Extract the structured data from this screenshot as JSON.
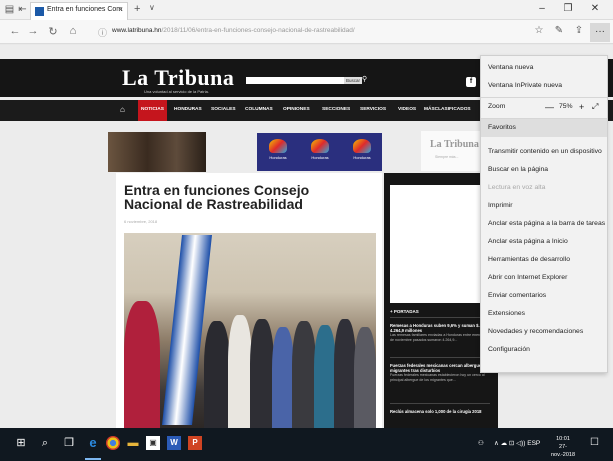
{
  "browser": {
    "tab_title": "Entra en funciones Com",
    "tab_close": "×",
    "new_tab": "+",
    "tab_dropdown": "∨",
    "window": {
      "minimize": "–",
      "maximize": "❐",
      "close": "✕"
    },
    "nav": {
      "back": "←",
      "forward": "→",
      "refresh": "↻",
      "home": "⌂"
    },
    "url_host": "www.latribuna.hn",
    "url_path": "/2018/11/06/entra-en-funciones-consejo-nacional-de-rastreabilidad/",
    "icons": {
      "reading": "☆",
      "favorites": "☆",
      "notes": "✎",
      "share": "⇪",
      "more": "···"
    }
  },
  "site": {
    "logo": "La Tribuna",
    "tagline": "Una voluntad al servicio de la Patria.",
    "search_button": "Buscar",
    "social": "f",
    "nav_items": [
      "NOTICIAS",
      "HONDURAS",
      "SOCIALES",
      "COLUMNAS",
      "OPINIONES",
      "SECCIONES",
      "SERVICIOS",
      "VIDEOS",
      "MÁSCLASIFICADOS"
    ],
    "ad2_labels": [
      "Honduras",
      "Honduras",
      "Honduras"
    ],
    "ad3_logo": "La Tribuna",
    "ad3_tag": "Siempre más..."
  },
  "article": {
    "title": "Entra en funciones Consejo Nacional de Rastreabilidad",
    "date": "6 noviembre, 2018"
  },
  "sidebar": {
    "heading": "+ PORTADAS",
    "items": [
      {
        "title": "Remesas a Honduras suben 9,6% y suman $. 4.264,9 millones",
        "sub": "Las remesas familiares enviadas a Honduras entre enero y 15 de noviembre pasados sumaron 4.264,9..."
      },
      {
        "title": "Fuerzas federales mexicanas cercan albergue de migrantes tras disturbios",
        "sub": "Fuerzas federales mexicanas establecieron hoy un cerco al principal albergue de los migrantes que..."
      },
      {
        "title": "Reclús almacena solo 1,000 de la cirugía 2018",
        "sub": ""
      }
    ]
  },
  "menu": {
    "items": [
      {
        "label": "Ventana nueva",
        "enabled": true
      },
      {
        "label": "Ventana InPrivate nueva",
        "enabled": true
      },
      {
        "label": "Zoom",
        "enabled": true,
        "zoom_value": "75%",
        "zoom_minus": "—",
        "zoom_plus": "+",
        "zoom_full": "⤢"
      },
      {
        "label": "Favoritos",
        "enabled": true,
        "highlighted": true
      },
      {
        "label": "Transmitir contenido en un dispositivo",
        "enabled": true
      },
      {
        "label": "Buscar en la página",
        "enabled": true
      },
      {
        "label": "Lectura en voz alta",
        "enabled": false
      },
      {
        "label": "Imprimir",
        "enabled": true
      },
      {
        "label": "Anclar esta página a la barra de tareas",
        "enabled": true
      },
      {
        "label": "Anclar esta página a Inicio",
        "enabled": true
      },
      {
        "label": "Herramientas de desarrollo",
        "enabled": true
      },
      {
        "label": "Abrir con Internet Explorer",
        "enabled": true
      },
      {
        "label": "Enviar comentarios",
        "enabled": true
      },
      {
        "label": "Extensiones",
        "enabled": true
      },
      {
        "label": "Novedades y recomendaciones",
        "enabled": true
      },
      {
        "label": "Configuración",
        "enabled": true
      }
    ]
  },
  "taskbar": {
    "start": "⊞",
    "search": "⌕",
    "task_view": "❒",
    "word": "W",
    "ppt": "P",
    "tray": "∧ ☁ ⊡ ◁)) ESP",
    "people": "⚇",
    "time": "10:01",
    "date": "27-nov.-2018",
    "notifications": "☐"
  }
}
